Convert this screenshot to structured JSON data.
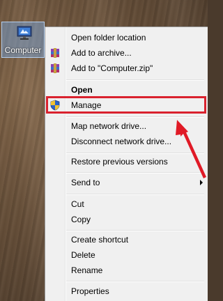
{
  "desktop_icon": {
    "label": "Computer",
    "icon": "computer-icon"
  },
  "menu": {
    "items": [
      {
        "label": "Open folder location",
        "icon": ""
      },
      {
        "label": "Add to archive...",
        "icon": "winrar-icon"
      },
      {
        "label": "Add to \"Computer.zip\"",
        "icon": "winrar-icon"
      },
      {
        "label": "Open",
        "icon": ""
      },
      {
        "label": "Manage",
        "icon": "uac-shield-icon"
      },
      {
        "label": "Map network drive...",
        "icon": ""
      },
      {
        "label": "Disconnect network drive...",
        "icon": ""
      },
      {
        "label": "Restore previous versions",
        "icon": ""
      },
      {
        "label": "Send to",
        "icon": "submenu-arrow-icon"
      },
      {
        "label": "Cut",
        "icon": ""
      },
      {
        "label": "Copy",
        "icon": ""
      },
      {
        "label": "Create shortcut",
        "icon": ""
      },
      {
        "label": "Delete",
        "icon": ""
      },
      {
        "label": "Rename",
        "icon": ""
      },
      {
        "label": "Properties",
        "icon": ""
      }
    ]
  },
  "annotation": {
    "highlight_color": "#d9222e",
    "highlighted_item": "Manage"
  }
}
